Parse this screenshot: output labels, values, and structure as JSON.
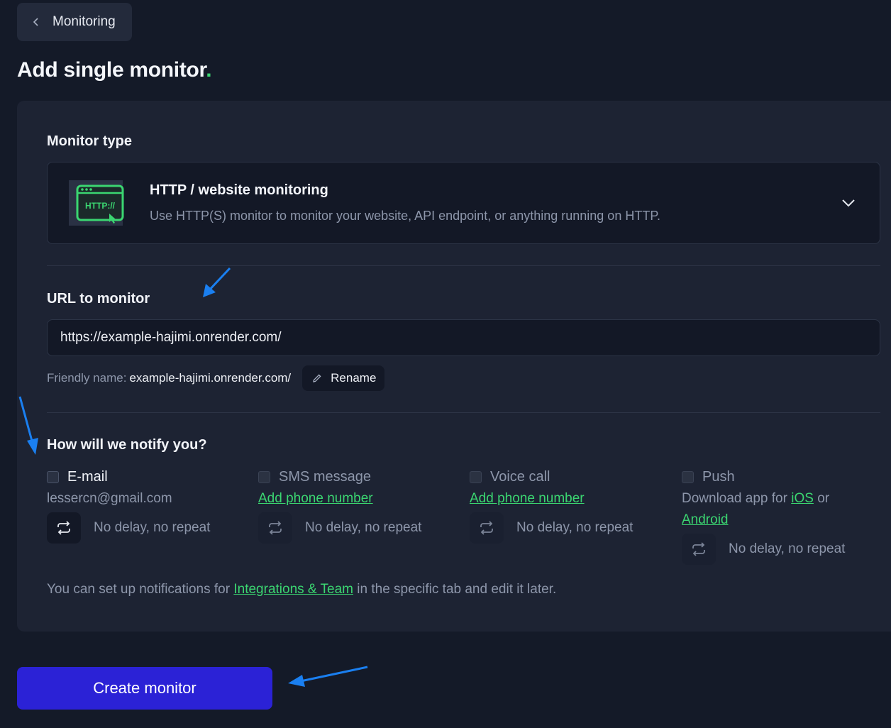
{
  "back": {
    "label": "Monitoring"
  },
  "page": {
    "title": "Add single monitor",
    "title_dot": "."
  },
  "monitor_type": {
    "label": "Monitor type",
    "selected_title": "HTTP / website monitoring",
    "selected_desc": "Use HTTP(S) monitor to monitor your website, API endpoint, or anything running on HTTP.",
    "icon_text": "HTTP://"
  },
  "url": {
    "label": "URL to monitor",
    "value": "https://example-hajimi.onrender.com/",
    "friendly_label": "Friendly name:",
    "friendly_value": "example-hajimi.onrender.com/",
    "rename_label": "Rename"
  },
  "notify": {
    "label": "How will we notify you?",
    "channels": [
      {
        "label": "E-mail",
        "sub": "lessercn@gmail.com",
        "repeat": "No delay, no repeat"
      },
      {
        "label": "SMS message",
        "link": "Add phone number",
        "repeat": "No delay, no repeat"
      },
      {
        "label": "Voice call",
        "link": "Add phone number",
        "repeat": "No delay, no repeat"
      },
      {
        "label": "Push",
        "sub_prefix": "Download app for",
        "ios": "iOS",
        "or": "or",
        "android": "Android",
        "repeat": "No delay, no repeat"
      }
    ],
    "footer_prefix": "You can set up notifications for",
    "footer_link": "Integrations & Team",
    "footer_suffix": "in the specific tab and edit it later."
  },
  "create": {
    "label": "Create monitor"
  },
  "colors": {
    "accent_green": "#3bd671",
    "primary_button": "#2b22d6",
    "annotation_arrow": "#1a7ff0"
  }
}
